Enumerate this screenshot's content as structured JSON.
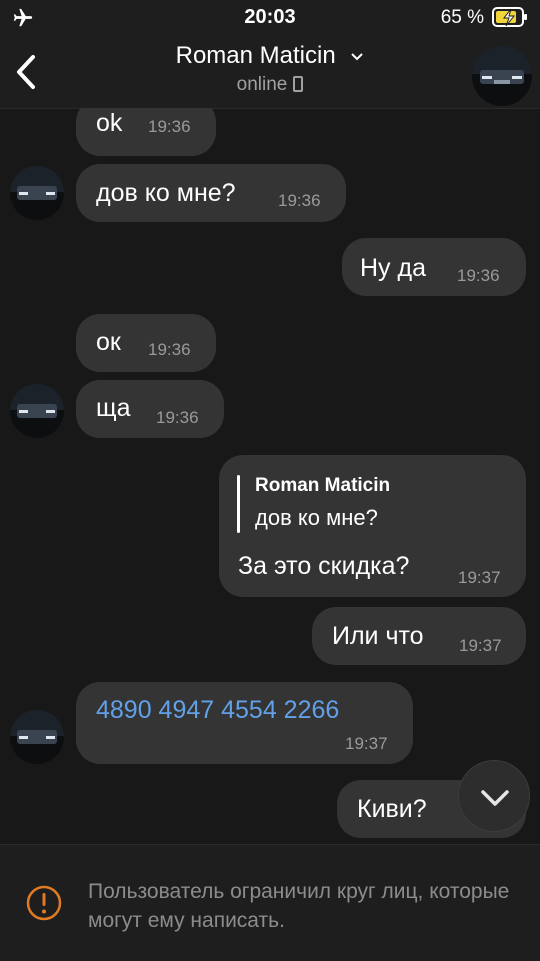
{
  "status_bar": {
    "time": "20:03",
    "battery": "65 %"
  },
  "header": {
    "title": "Roman Maticin",
    "status": "online",
    "back_icon": "chevron-left-icon"
  },
  "messages": [
    {
      "id": "m1",
      "direction": "incoming",
      "text": "ok",
      "time": "19:36"
    },
    {
      "id": "m2",
      "direction": "incoming",
      "text": "дов ко мне?",
      "time": "19:36"
    },
    {
      "id": "m3",
      "direction": "outgoing",
      "text": "Ну да",
      "time": "19:36"
    },
    {
      "id": "m4",
      "direction": "incoming",
      "text": "ок",
      "time": "19:36"
    },
    {
      "id": "m5",
      "direction": "incoming",
      "text": "ща",
      "time": "19:36"
    },
    {
      "id": "m6",
      "direction": "outgoing",
      "reply_to": {
        "name": "Roman Maticin",
        "text": "дов ко мне?"
      },
      "text": "За это скидка?",
      "time": "19:37"
    },
    {
      "id": "m7",
      "direction": "outgoing",
      "text": "Или что",
      "time": "19:37"
    },
    {
      "id": "m8",
      "direction": "incoming",
      "text": "4890 4947 4554 2266",
      "time": "19:37",
      "link_color": "#62a0e8"
    },
    {
      "id": "m9",
      "direction": "outgoing",
      "text": "Киви?",
      "time": ""
    }
  ],
  "bottom_notice": {
    "text": "Пользователь ограничил круг лиц, которые могут ему написать.",
    "icon": "warning-icon",
    "icon_color": "#e07b25"
  },
  "colors": {
    "background": "#181818",
    "bubble": "#343434",
    "bar": "#1e1e1e",
    "accent": "#62a0e8"
  }
}
